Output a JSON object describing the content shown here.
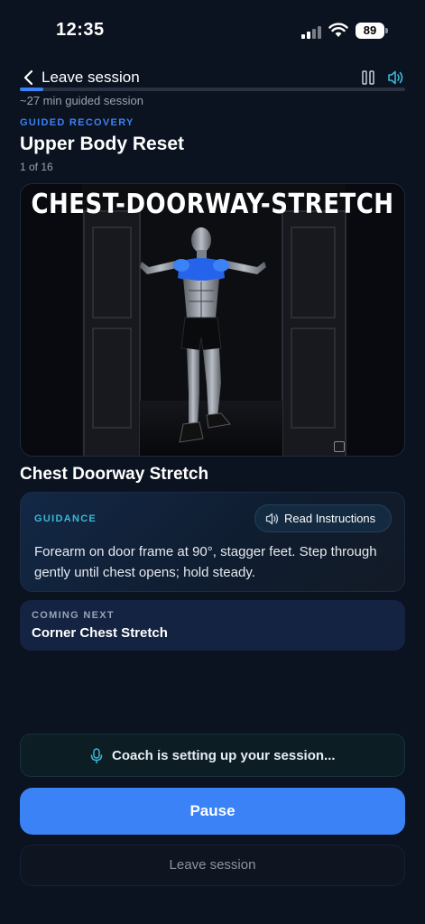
{
  "status_bar": {
    "time": "12:35",
    "battery": "89"
  },
  "header": {
    "back_label": "Leave session",
    "progress_fraction": 0.06,
    "duration": "~27 min guided session"
  },
  "session": {
    "kicker": "GUIDED RECOVERY",
    "title": "Upper Body Reset",
    "step_count": "1 of 16"
  },
  "exercise": {
    "image_caption": "CHEST-DOORWAY-STRETCH",
    "name": "Chest Doorway Stretch"
  },
  "guidance": {
    "label": "GUIDANCE",
    "read_button": "Read Instructions",
    "text": "Forearm on door frame at 90°, stagger feet. Step through gently until chest opens; hold steady."
  },
  "coming_next": {
    "label": "COMING NEXT",
    "title": "Corner Chest Stretch"
  },
  "coach": {
    "status": "Coach is setting up your session..."
  },
  "actions": {
    "pause": "Pause",
    "leave": "Leave session"
  },
  "colors": {
    "accent": "#3b82f6",
    "teal": "#3bb7d6",
    "background": "#0b1220"
  },
  "icons": [
    "signal-icon",
    "wifi-icon",
    "battery-icon",
    "back-chevron-icon",
    "pause-icon",
    "speaker-icon",
    "microphone-icon",
    "expand-icon"
  ]
}
